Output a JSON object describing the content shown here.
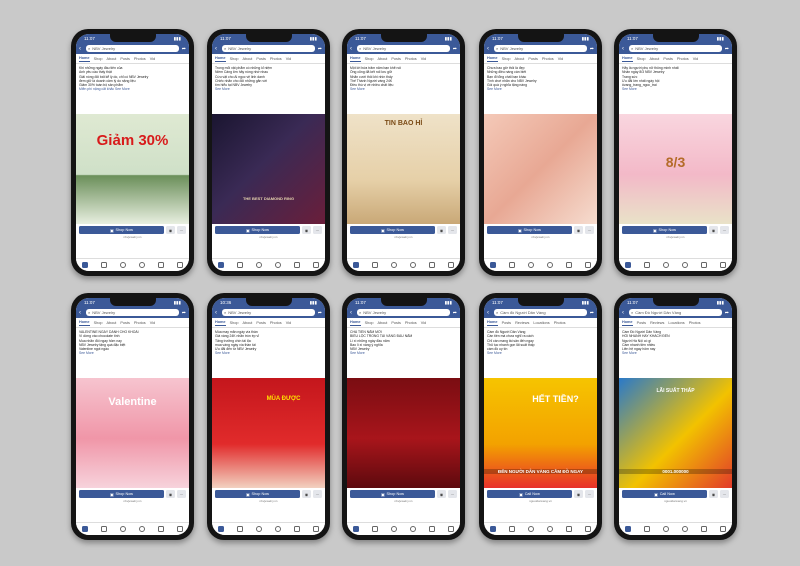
{
  "phones": [
    {
      "time": "11:07",
      "search": "NBV Jewelry",
      "tabs": [
        "Home",
        "Shop",
        "About",
        "Posts",
        "Photos",
        "Vid"
      ],
      "post": [
        "Khi những ngày đầu tiên của",
        "Anh yêu cầu thấy thật",
        "Giải nồng đôi bất kể lý do, chỉ có NBV Jewelry",
        "đem giữ là doanh cảm lý do nặng liệu",
        "Giảm 30% toàn bộ sản phẩm",
        "Miễn phí nặng cắt khắc See More"
      ],
      "overlay": "Giảm 30%",
      "cta": "Shop Now",
      "url": "nbvjewelry.vn"
    },
    {
      "time": "11:07",
      "search": "NBV Jewelry",
      "tabs": [
        "Home",
        "Shop",
        "About",
        "Posts",
        "Photos",
        "Vid"
      ],
      "post": [
        "Trong mỗi vật phẩm có những kỉ niệm",
        "Niềm Cảng lớn hãy nồng nhớ nhau",
        "Cứu vật cho Ai ngọc vệ linh danh",
        "Chiếc nhẫn cho đôi những gắn với",
        "tìm hiểu tại NBV Jewelry",
        "See More"
      ],
      "overlay": "THE BEST DIAMOND RING",
      "cta": "Shop Now",
      "url": "nbvjewelry.vn"
    },
    {
      "time": "11:07",
      "search": "NBV Jewelry",
      "tabs": [
        "Home",
        "Shop",
        "About",
        "Posts",
        "Photos",
        "Vid"
      ],
      "post": [
        "Một lời hứa trăm năm bạn khẽ nói",
        "Ông cũng đã kết nối lưu giữ",
        "Nhẫn cưới thôi khi nhìn thấy",
        "Thế Thành Người vàng 24K",
        "Điều thú vị về nhiều chất liệu",
        "See More"
      ],
      "overlay": "TIN BAO HỈ",
      "cta": "Shop Now",
      "url": "nbvjewelry.vn"
    },
    {
      "time": "11:07",
      "search": "NBV Jewelry",
      "tabs": [
        "Home",
        "Shop",
        "About",
        "Posts",
        "Photos",
        "Vid"
      ],
      "post": [
        "Chưa bao giờ thôi là đẹp",
        "Những điều nàng cần biết",
        "Bạn đi tổng chất bạn khác",
        "Tình chơi nhẫn cho NBV Jewelry",
        "Gói quà ý nghĩa tặng nàng",
        "See More"
      ],
      "overlay": "",
      "cta": "Shop Now",
      "url": "nbvjewelry.vn"
    },
    {
      "time": "11:07",
      "search": "NBV Jewelry",
      "tabs": [
        "Home",
        "Shop",
        "About",
        "Posts",
        "Photos",
        "Vid"
      ],
      "post": [
        "Hãy là người phụ nữ thông minh nhất",
        "Nhân ngày 8/3 NBV Jewelry",
        "Trang sức",
        "Ưu đãi lớn nhất ngày hội",
        "#vang_trang_ngoc_trai",
        "See More"
      ],
      "overlay": "8/3",
      "cta": "Shop Now",
      "url": "nbvjewelry.vn"
    },
    {
      "time": "11:07",
      "search": "NBV Jewelry",
      "tabs": [
        "Home",
        "Shop",
        "About",
        "Posts",
        "Photos",
        "Vid"
      ],
      "post": [
        "VALENTINE NGÀY DÀNH CHO KHOẢI",
        "Vì dừng vào chocolate tình",
        "Mua nhẫn đôi ngay hôm nay",
        "NBV Jewelry tặng quà đặc biệt",
        "Valentine ngọt ngào",
        "See More"
      ],
      "overlay": "Valentine",
      "cta": "Shop Now",
      "url": "nbvjewelry.vn"
    },
    {
      "time": "10:36",
      "search": "NBV Jewelry",
      "tabs": [
        "Home",
        "Shop",
        "About",
        "Posts",
        "Photos",
        "Vid"
      ],
      "post": [
        "Mùa may mắn ngày vía thần",
        "Giá vàng 24K nhẫn tròn ép vỉ",
        "Tăng trưởng chín tài lộc",
        "mua vàng ngày vía thần tài",
        "Ưu đãi đến từ NBV Jewelry",
        "See More"
      ],
      "overlay": "MÙA ĐƯỢC",
      "cta": "Shop Now",
      "url": "nbvjewelry.vn"
    },
    {
      "time": "11:07",
      "search": "NBV Jewelry",
      "tabs": [
        "Home",
        "Shop",
        "About",
        "Posts",
        "Photos",
        "Vid"
      ],
      "post": [
        "CHÀ TIỀN NĂM MỚI",
        "BIỂU LỘC TRONG TÀI VÀNG ĐẦU NĂM",
        "Lì xì những ngày đầu năm",
        "Bao lì xì vàng ý nghĩa",
        "NBV Jewelry",
        "See More"
      ],
      "overlay": "",
      "cta": "Shop Now",
      "url": "nbvjewelry.vn"
    },
    {
      "time": "11:07",
      "search": "Cầm đồ Người Dân Vàng",
      "tabs": [
        "Home",
        "Posts",
        "Reviews",
        "Locations",
        "Photos"
      ],
      "post": [
        "Cầm đồ Người Dân Vàng",
        "Cần tiền mà chưa nghĩ ra cách",
        "Chỉ cần mang tài sản đến ngay",
        "Thủ tục nhanh gọn lãi suất thấp",
        "cầm đồ uy tín",
        "See More"
      ],
      "overlay": "HẾT TIỀN?",
      "overlay2": "ĐẾN NGƯỜI DÂN VÀNG CẦM ĐỒ NGAY",
      "cta": "Call Now",
      "url": "nguoidanvang.vn"
    },
    {
      "time": "11:07",
      "search": "Cầm Đồ Người Dân Vàng",
      "tabs": [
        "Home",
        "Posts",
        "Reviews",
        "Locations",
        "Photos"
      ],
      "post": [
        "Cầm Đồ Người Dân Vàng",
        "HỎI NHANH HAY KHÁCH ĐẾN",
        "Người Hà Nội có gì",
        "Cầm nhanh tiền nhiều",
        "Liên hệ ngay hôm nay",
        "See More"
      ],
      "overlay": "LÃI SUẤT THẤP",
      "overlay2": "0001.000000",
      "cta": "Call Now",
      "url": "nguoidanvang.vn"
    }
  ],
  "colors": {
    "fb_blue": "#3b5998",
    "background": "#c9c9c9"
  },
  "icons": [
    "back-arrow-icon",
    "search-icon",
    "share-icon",
    "ellipsis-icon",
    "messenger-icon",
    "home-icon",
    "video-icon",
    "marketplace-icon",
    "groups-icon",
    "bell-icon",
    "menu-icon"
  ]
}
